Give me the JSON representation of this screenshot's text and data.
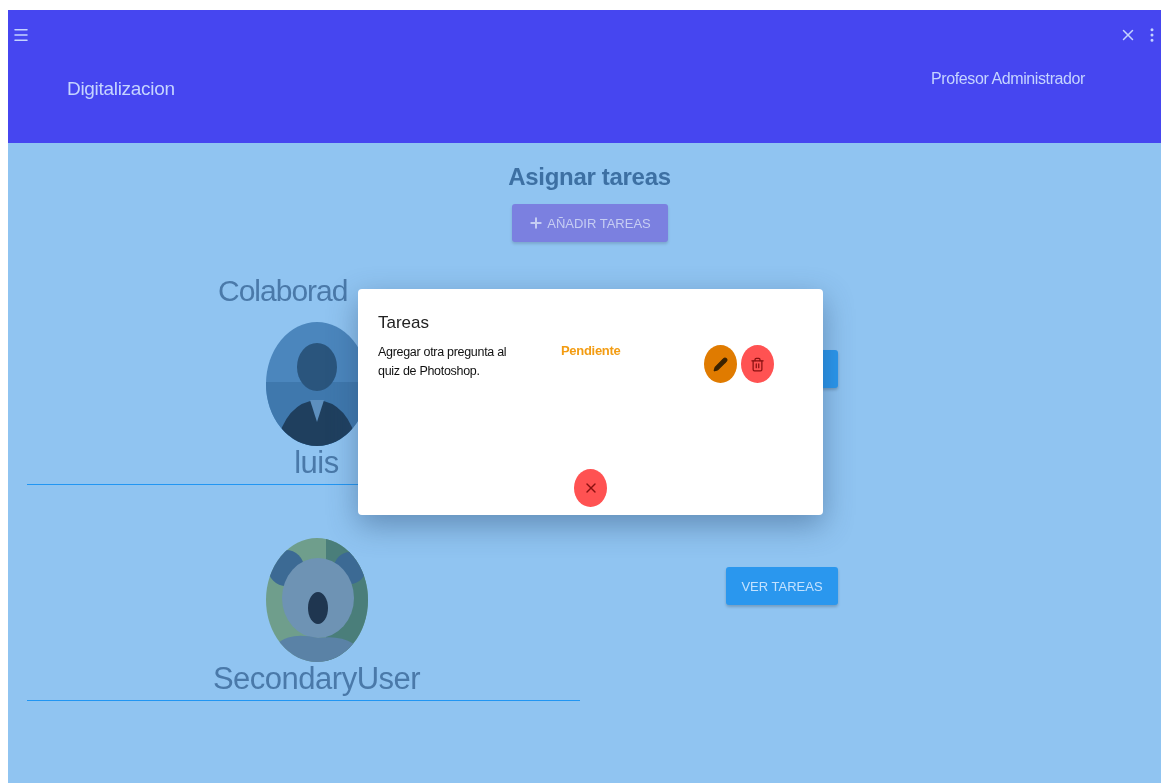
{
  "app_bar": {
    "title": "Digitalizacion",
    "user": "Profesor Administrador"
  },
  "page": {
    "heading": "Asignar tareas",
    "add_button": "AÑADIR TAREAS",
    "section_title": "Colaborad",
    "collaborators": [
      {
        "name": "luis",
        "kind": "person"
      },
      {
        "name": "SecondaryUser",
        "kind": "animal",
        "button": "VER TAREAS"
      }
    ]
  },
  "dialog": {
    "title": "Tareas",
    "tasks": [
      {
        "description": "Agregar otra pregunta al quiz de Photoshop.",
        "status": "Pendiente"
      }
    ]
  }
}
